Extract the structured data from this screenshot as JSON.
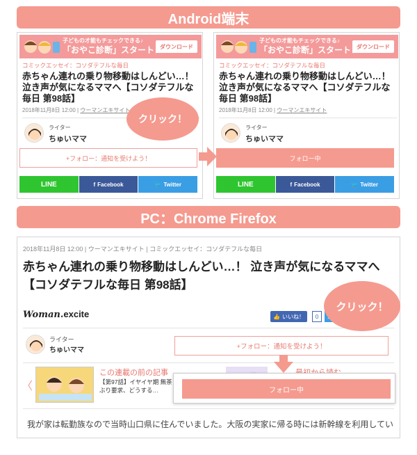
{
  "android_section": {
    "title": "Android端末"
  },
  "pc_section": {
    "title": "PC：Chrome Firefox"
  },
  "phone": {
    "banner": {
      "line1": "子どもの才能もチェックできる♪",
      "line2": "「おやこ診断」スタート！",
      "button": "ダウンロード"
    },
    "category": "コミックエッセイ：コソダテフルな毎日",
    "title": "赤ちゃん連れの乗り物移動はしんどい…！泣き声が気になるママへ【コソダテフルな毎日 第98話】",
    "date": "2018年11月8日 12:00",
    "separator": "|",
    "source": "ウーマンエキサイト",
    "writer_role": "ライター",
    "writer_name": "ちゅいママ",
    "follow_label": "+フォロー：通知を受けよう！",
    "following_label": "フォロー中",
    "share_line": "LINE",
    "share_facebook": "Facebook",
    "share_twitter": "Twitter"
  },
  "click_bubble": "クリック！",
  "pc": {
    "meta": "2018年11月8日 12:00 | ウーマンエキサイト | コミックエッセイ：コソダテフルな毎日",
    "title": "赤ちゃん連れの乗り物移動はしんどい…！ 泣き声が気になるママへ【コソダテフルな毎日 第98話】",
    "logo_prefix": "Woman.",
    "logo_suffix": "excite",
    "like_label": "いいね！",
    "like_count": "0",
    "twitter_partial": "シ",
    "writer_role": "ライター",
    "writer_name": "ちゅいママ",
    "follow_label": "+フォロー：通知を受けよう！",
    "following_label": "フォロー中",
    "prev_arrow": "〈",
    "prev_label": "この連載の前の記事",
    "prev_text": "【第97話】イヤイヤ期 無茶ぶり要求、どうする…",
    "next_label": "最初から読む",
    "body": "我が家は転勤族なので当時山口県に住んでいました。大阪の実家に帰る時には新幹線を利用していました。"
  },
  "colors": {
    "accent": "#f59a8f",
    "accent_text": "#e8776f",
    "line": "#2fc530",
    "facebook": "#3b5998",
    "twitter": "#3a9ee4"
  }
}
